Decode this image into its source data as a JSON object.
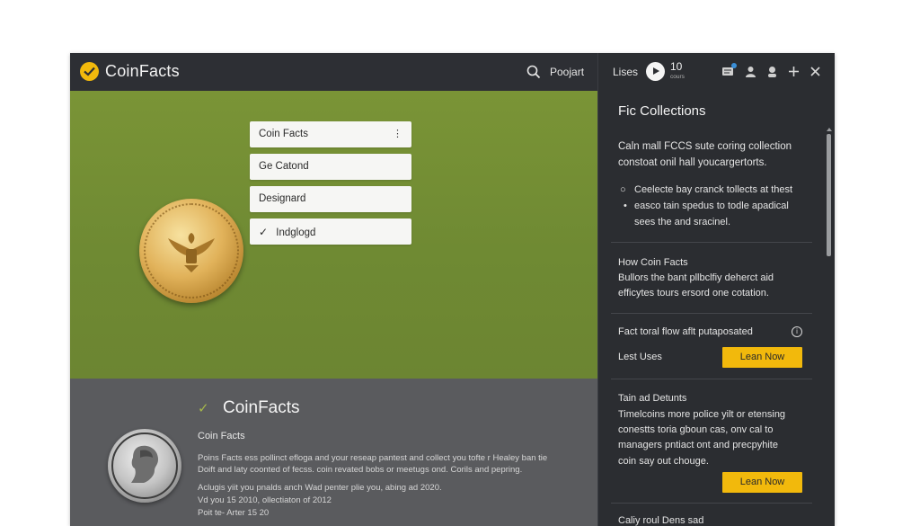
{
  "app": {
    "title": "CoinFacts"
  },
  "header": {
    "search_label": "Poojart"
  },
  "hero": {
    "menu_items": [
      {
        "label": "Coin Facts"
      },
      {
        "label": "Ge Catond"
      },
      {
        "label": "Designard"
      },
      {
        "label": "Indglogd",
        "checked": true
      }
    ],
    "menu_more": "⋮",
    "check_glyph": "✓"
  },
  "lower": {
    "title": "CoinFacts",
    "subtitle": "Coin Facts",
    "body": "Poins Facts ess pollinct efloga and your reseap pantest and collect you tofte r Healey ban tie Doift and laty coonted of fecss. coin revated bobs or meetugs ond. Corils and pepring.",
    "meta1": "Aclugis yiit you pnalds anch Wad penter plie you, abing ad 2020.",
    "meta2": "Vd you 15 2010, ollectiaton of 2012",
    "meta3": "Poit te- Arter 15 20"
  },
  "right_panel": {
    "top_label": "Lises",
    "count": "10",
    "count_sub": "cours",
    "title": "Fic Collections",
    "intro_line1": "Caln mall FCCS sute coring collection",
    "intro_line2": "constoat onil hall youcargertorts.",
    "bullet1": "Ceelecte bay cranck tollects at thest",
    "bullet2_line1": "easco tain spedus to todle apadical",
    "bullet2_line2": "sees the and sracinel.",
    "section2_title": "How Coin Facts",
    "section2_line1": "Bullors the bant pllbclfiy deherct aid",
    "section2_line2": "efficytes tours ersord one cotation.",
    "section3_title": "Fact toral flow aflt putaposated",
    "section3_label": "Lest Uses",
    "learn_now": "Lean Now",
    "section4_title": "Tain ad Detunts",
    "section4_line1": "Timelcoins more police yilt or etensing",
    "section4_line2": "conestts toria gboun cas, onv cal to",
    "section4_line3": "managers pntiact ont and precpyhite",
    "section4_line4": "coin say out chouge.",
    "learn_now2": "Lean Now",
    "section5_title": "Caliy roul Dens sad"
  },
  "colors": {
    "accent": "#f2b90c",
    "hero_green": "#748f34",
    "panel": "#2b2d31"
  }
}
